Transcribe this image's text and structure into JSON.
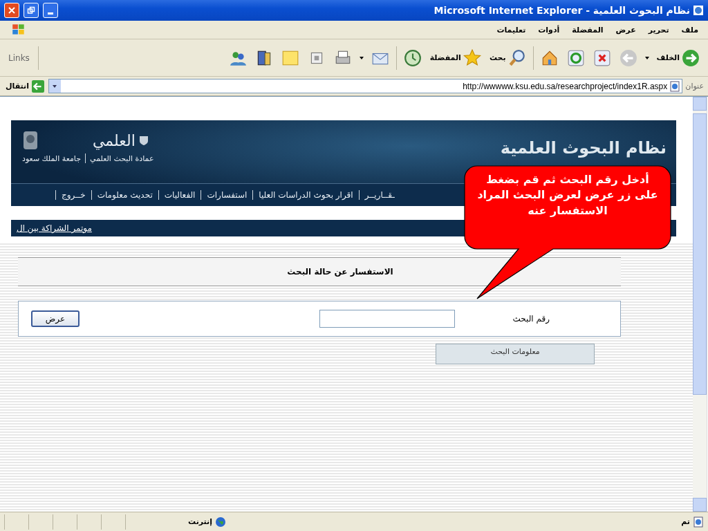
{
  "window": {
    "title": "نظام البحوث العلمية - Microsoft Internet Explorer"
  },
  "menu": [
    "ملف",
    "تحرير",
    "عرض",
    "المفضلة",
    "أدوات",
    "تعليمات"
  ],
  "toolbar": [
    {
      "kind": "back",
      "label": "الخلف"
    },
    {
      "kind": "forward"
    },
    {
      "kind": "stop"
    },
    {
      "kind": "refresh"
    },
    {
      "kind": "home"
    },
    {
      "kind": "search",
      "label": "بحث"
    },
    {
      "kind": "favorites",
      "label": "المفضلة"
    },
    {
      "kind": "history"
    },
    {
      "kind": "mail"
    },
    {
      "kind": "print"
    },
    {
      "kind": "window"
    },
    {
      "kind": "note"
    },
    {
      "kind": "book"
    },
    {
      "kind": "people"
    }
  ],
  "links": "Links",
  "address": {
    "label": "عنوان",
    "url": "http://wwwww.ksu.edu.sa/researchproject/index1R.aspx",
    "go": "انتقال"
  },
  "banner": {
    "title": "نظام البحوث العلمية",
    "logo_text": "العلمي",
    "deanship": "عمادة البحث العلمي",
    "university": "جامعة الملك سعود",
    "nav": [
      "ـقــاريــر",
      "اقرار بحوث الدراسات العليا",
      "استفسارات",
      "الفعاليات",
      "تحديث معلومات",
      "خــروج"
    ]
  },
  "marquee_link": "موتمر الشراكة بين ال",
  "form": {
    "heading": "الاستفسار عن حالة البحث",
    "field_label": "رقم البحث",
    "button": "عرض",
    "info_tab": "معلومات البحث"
  },
  "callout": "أدخل رقم البحث ثم  قم بضغط على زر عرض لعرض  البحث المراد الاستفسار عنه",
  "status": {
    "text": "تم",
    "zone": "إنترنت"
  }
}
